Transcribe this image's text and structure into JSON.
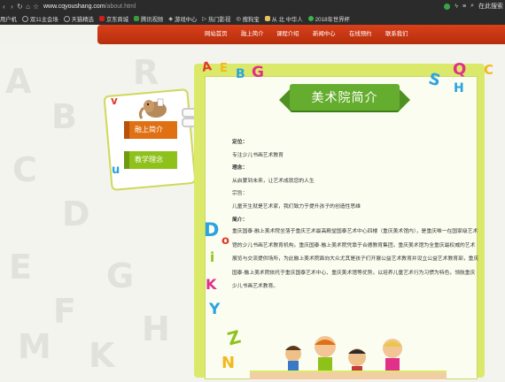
{
  "browser": {
    "url_host": "www.cqyoushang.com",
    "url_path": "/about.html",
    "right_text": "在此搜索",
    "bookmarks": [
      "用户机",
      "双11主会场",
      "天猫精选",
      "京东商城",
      "腾讯视频",
      "游戏中心",
      "热门影视",
      "搜狗宝",
      "从 北 中华人",
      "2018年世界杯"
    ]
  },
  "nav": {
    "items": [
      "网站首页",
      "融上简介",
      "课程介绍",
      "新闻中心",
      "在线预约",
      "联系我们"
    ]
  },
  "sidebar": {
    "items": [
      "融上简介",
      "教学理念"
    ]
  },
  "content": {
    "title": "美术院简介",
    "lines": [
      {
        "label": "定位：",
        "text": "专注少儿书画艺术教育"
      },
      {
        "label": "理念：",
        "text": "从启蒙到未来，让艺术成就您的人生"
      },
      {
        "label": "宗旨：",
        "text": "儿童天生就是艺术家，我们致力于提升孩子的创造性思维"
      }
    ],
    "intro_label": "简介：",
    "intro": "重庆国泰·融上美术院坐落于重庆艺术最高殿堂国泰艺术中心四楼（重庆美术馆内），是重庆唯一在国家级艺术馆的少儿书画艺术教育机构。重庆国泰·融上美术院凭靠于合德教育集团，重庆美术馆为全重庆最权威的艺术展览与交流提供场所，为此融上美术院面向大众尤其是孩子们开展公益艺术教育并设立公益艺术教育部，重庆国泰·融上美术院依托于重庆国泰艺术中心、重庆美术馆等优势，以培养儿童艺术行为习惯为特色，领航重庆少儿书画艺术教育。"
  },
  "colors": {
    "nav": "#c7360f",
    "panel": "#dbe96a",
    "banner": "#64ad2e",
    "menu_orange": "#e07014",
    "menu_green": "#8ec21b"
  }
}
